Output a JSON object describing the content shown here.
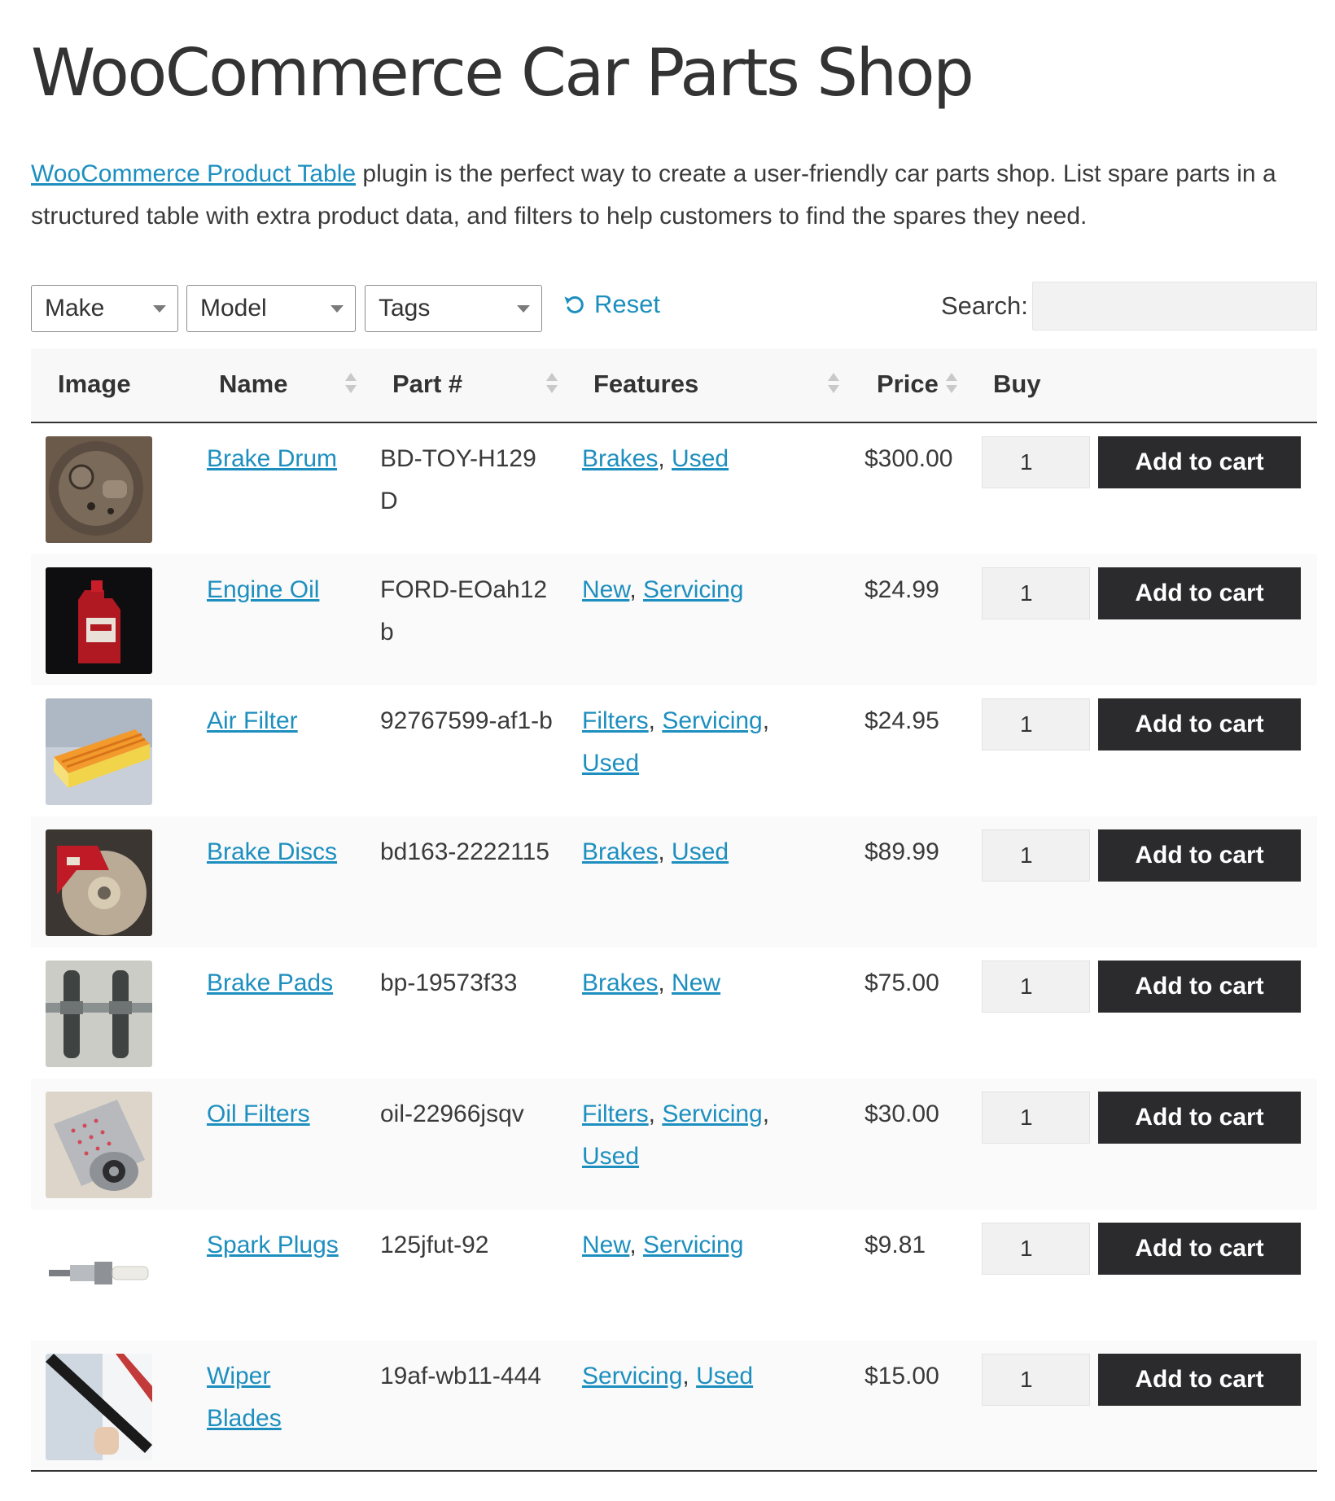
{
  "page": {
    "title": "WooCommerce Car Parts Shop",
    "intro_link": "WooCommerce Product Table",
    "intro_text": " plugin is the perfect way to create a user-friendly car parts shop. List spare parts in a structured table with extra product data, and filters to help customers to find the spares they need."
  },
  "filters": {
    "make": "Make",
    "model": "Model",
    "tags": "Tags",
    "reset": "Reset",
    "search_label": "Search:"
  },
  "table": {
    "headers": {
      "image": "Image",
      "name": "Name",
      "part": "Part #",
      "features": "Features",
      "price": "Price",
      "buy": "Buy"
    },
    "button_label": "Add to cart",
    "rows": [
      {
        "name": "Brake Drum",
        "part": "BD-TOY-H129D",
        "features": [
          "Brakes",
          "Used"
        ],
        "price": "$300.00",
        "qty": "1",
        "image": "brake-drum"
      },
      {
        "name": "Engine Oil",
        "part": "FORD-EOah12b",
        "features": [
          "New",
          "Servicing"
        ],
        "price": "$24.99",
        "qty": "1",
        "image": "engine-oil"
      },
      {
        "name": "Air Filter",
        "part": "92767599-af1-b",
        "features": [
          "Filters",
          "Servicing",
          "Used"
        ],
        "price": "$24.95",
        "qty": "1",
        "image": "air-filter"
      },
      {
        "name": "Brake Discs",
        "part": "bd163-2222115",
        "features": [
          "Brakes",
          "Used"
        ],
        "price": "$89.99",
        "qty": "1",
        "image": "brake-discs"
      },
      {
        "name": "Brake Pads",
        "part": "bp-19573f33",
        "features": [
          "Brakes",
          "New"
        ],
        "price": "$75.00",
        "qty": "1",
        "image": "brake-pads"
      },
      {
        "name": "Oil Filters",
        "part": "oil-22966jsqv",
        "features": [
          "Filters",
          "Servicing",
          "Used"
        ],
        "price": "$30.00",
        "qty": "1",
        "image": "oil-filters"
      },
      {
        "name": "Spark Plugs",
        "part": "125jfut-92",
        "features": [
          "New",
          "Servicing"
        ],
        "price": "$9.81",
        "qty": "1",
        "image": "spark-plugs"
      },
      {
        "name": "Wiper Blades",
        "part": "19af-wb11-444",
        "features": [
          "Servicing",
          "Used"
        ],
        "price": "$15.00",
        "qty": "1",
        "image": "wiper-blades"
      }
    ]
  }
}
